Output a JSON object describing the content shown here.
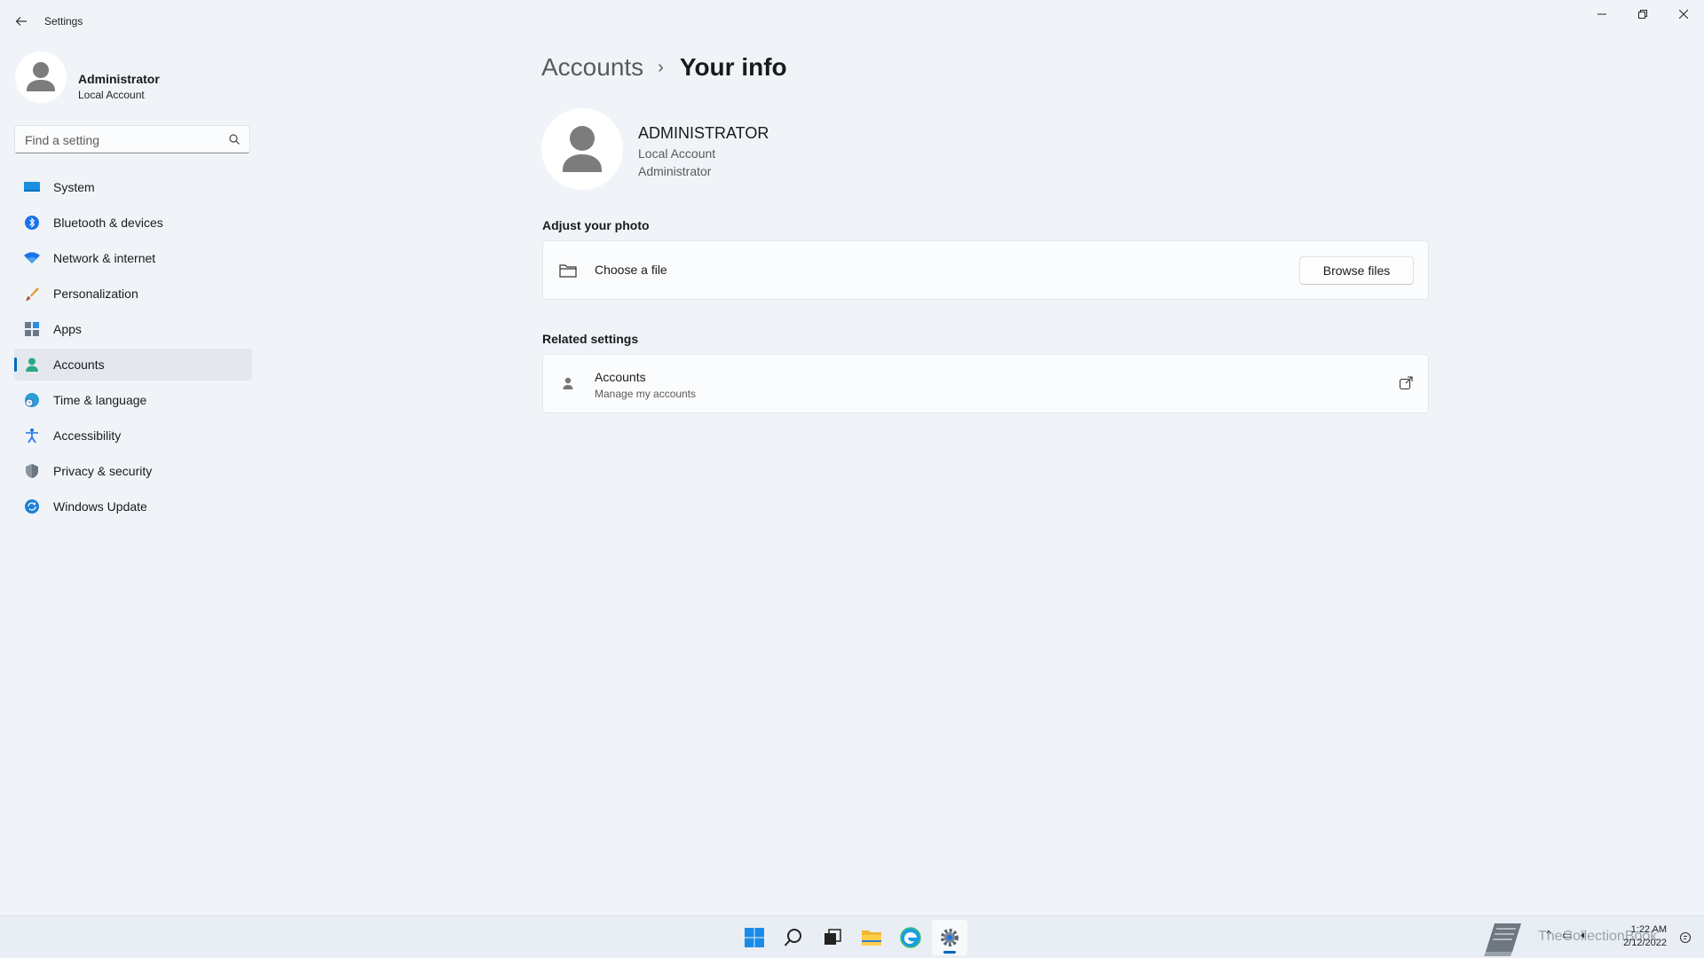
{
  "window": {
    "title": "Settings",
    "controls": {
      "minimize": "—",
      "restore": "❐",
      "close": "✕"
    }
  },
  "profile": {
    "name": "Administrator",
    "account_type": "Local Account"
  },
  "search": {
    "placeholder": "Find a setting"
  },
  "nav": {
    "items": [
      {
        "label": "System",
        "icon": "monitor-icon",
        "active": false
      },
      {
        "label": "Bluetooth & devices",
        "icon": "bluetooth-icon",
        "active": false
      },
      {
        "label": "Network & internet",
        "icon": "wifi-icon",
        "active": false
      },
      {
        "label": "Personalization",
        "icon": "brush-icon",
        "active": false
      },
      {
        "label": "Apps",
        "icon": "apps-icon",
        "active": false
      },
      {
        "label": "Accounts",
        "icon": "person-icon",
        "active": true
      },
      {
        "label": "Time & language",
        "icon": "globe-clock-icon",
        "active": false
      },
      {
        "label": "Accessibility",
        "icon": "accessibility-icon",
        "active": false
      },
      {
        "label": "Privacy & security",
        "icon": "shield-icon",
        "active": false
      },
      {
        "label": "Windows Update",
        "icon": "update-icon",
        "active": false
      }
    ]
  },
  "breadcrumb": {
    "parent": "Accounts",
    "separator": "›",
    "current": "Your info"
  },
  "user": {
    "name": "ADMINISTRATOR",
    "account_type": "Local Account",
    "role": "Administrator"
  },
  "adjust_photo": {
    "title": "Adjust your photo",
    "choose_label": "Choose a file",
    "browse_label": "Browse files"
  },
  "related": {
    "title": "Related settings",
    "accounts_title": "Accounts",
    "accounts_sub": "Manage my accounts"
  },
  "taskbar": {
    "watermark": "TheCollectionBook",
    "time": "1:22 AM",
    "date": "2/12/2022"
  },
  "colors": {
    "accent": "#0067c0",
    "background": "#f0f4f9",
    "card": "#fbfcfd"
  }
}
